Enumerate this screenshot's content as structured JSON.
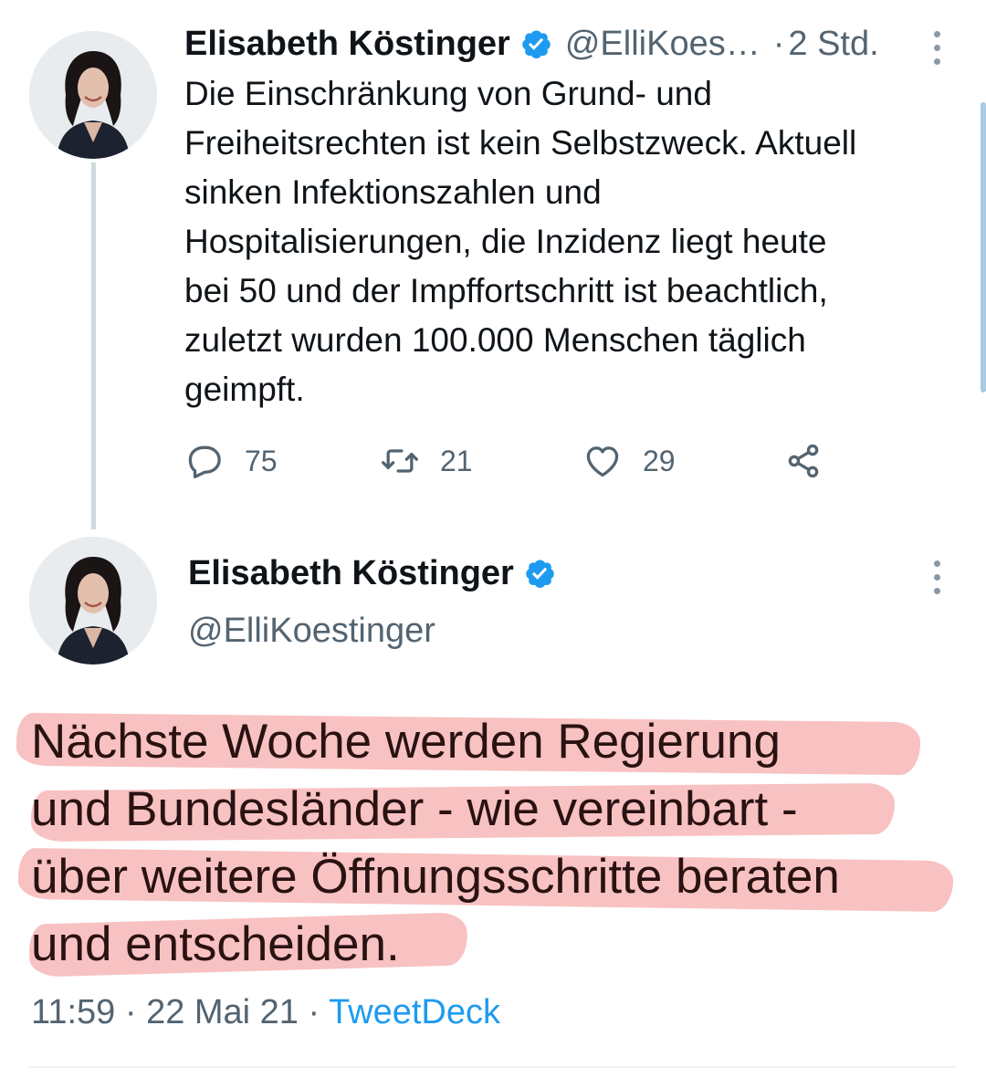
{
  "tweet1": {
    "author_name": "Elisabeth Köstinger",
    "handle": "@ElliKoes…",
    "separator": "·",
    "age": "2 Std.",
    "text_lines": [
      "Die Einschränkung von Grund- und",
      "Freiheitsrechten ist kein Selbstzweck. Aktuell",
      "sinken Infektionszahlen und",
      "Hospitalisierungen, die Inzidenz liegt heute",
      "bei 50 und der Impffortschritt ist beachtlich,",
      "zuletzt wurden 100.000 Menschen täglich",
      "geimpft."
    ],
    "replies": "75",
    "retweets": "21",
    "likes": "29"
  },
  "tweet2": {
    "author_name": "Elisabeth Köstinger",
    "handle": "@ElliKoestinger",
    "text_lines": [
      "Nächste Woche werden Regierung",
      "und Bundesländer - wie vereinbart -",
      "über weitere Öffnungsschritte beraten",
      "und entscheiden."
    ],
    "time": "11:59",
    "separator": "·",
    "date": "22 Mai 21",
    "source": "TweetDeck"
  },
  "colors": {
    "verified_blue": "#1d9bf0",
    "secondary_text": "#536471",
    "highlight": "#f08080"
  },
  "icons": [
    "verified-badge-icon",
    "more-options-icon",
    "reply-icon",
    "retweet-icon",
    "like-icon",
    "share-icon"
  ]
}
